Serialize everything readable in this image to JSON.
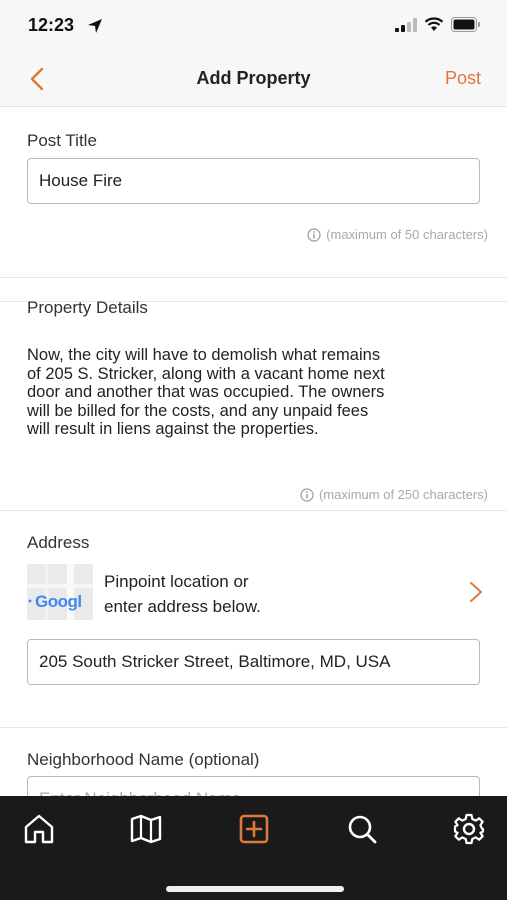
{
  "status": {
    "time": "12:23"
  },
  "nav": {
    "title": "Add Property",
    "post_label": "Post"
  },
  "post_title": {
    "label": "Post Title",
    "value": "House Fire",
    "hint": "(maximum of 50 characters)"
  },
  "details": {
    "label": "Property Details",
    "lines": [
      "Now, the city will have to demolish what remains",
      "of 205 S. Stricker, along with a vacant home next",
      "door and another that was occupied. The owners",
      "will be billed for the costs, and any unpaid fees",
      "will result in liens against the properties."
    ],
    "hint": "(maximum of 250 characters)"
  },
  "address": {
    "label": "Address",
    "map_logo_text": "Googl",
    "pinpoint_line1": "Pinpoint location or",
    "pinpoint_line2": "enter address below.",
    "value": "205 South Stricker Street, Baltimore, MD, USA"
  },
  "neighborhood": {
    "label": "Neighborhood Name (optional)",
    "placeholder": "Enter Neighborhood Name"
  },
  "tabs": [
    {
      "name": "home",
      "icon": "home-icon"
    },
    {
      "name": "map",
      "icon": "map-icon"
    },
    {
      "name": "add",
      "icon": "add-square-icon",
      "active": true
    },
    {
      "name": "search",
      "icon": "search-icon"
    },
    {
      "name": "settings",
      "icon": "gear-icon"
    }
  ],
  "colors": {
    "accent": "#e0783a",
    "tab_bar": "#1a1a1a",
    "background": "#ffffff"
  }
}
